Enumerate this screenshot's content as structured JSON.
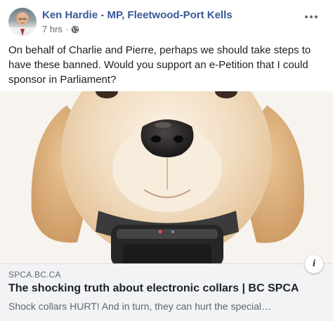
{
  "post": {
    "author": "Ken Hardie - MP, Fleetwood-Port Kells",
    "time": "7 hrs",
    "separator": "·",
    "privacy_icon": "globe-icon",
    "text": "On behalf of Charlie and Pierre, perhaps we should take steps to have these banned. Would you support an e-Petition that I could sponsor in Parliament?"
  },
  "link": {
    "domain": "SPCA.BC.CA",
    "title": "The shocking truth about electronic collars | BC SPCA",
    "description": "Shock collars HURT! And in turn, they can hurt the special…",
    "info_label": "i",
    "image_subject": "golden retriever puppy wearing a shock collar"
  },
  "colors": {
    "author": "#385898",
    "meta": "#65676b",
    "footer_bg": "#f2f3f5"
  }
}
